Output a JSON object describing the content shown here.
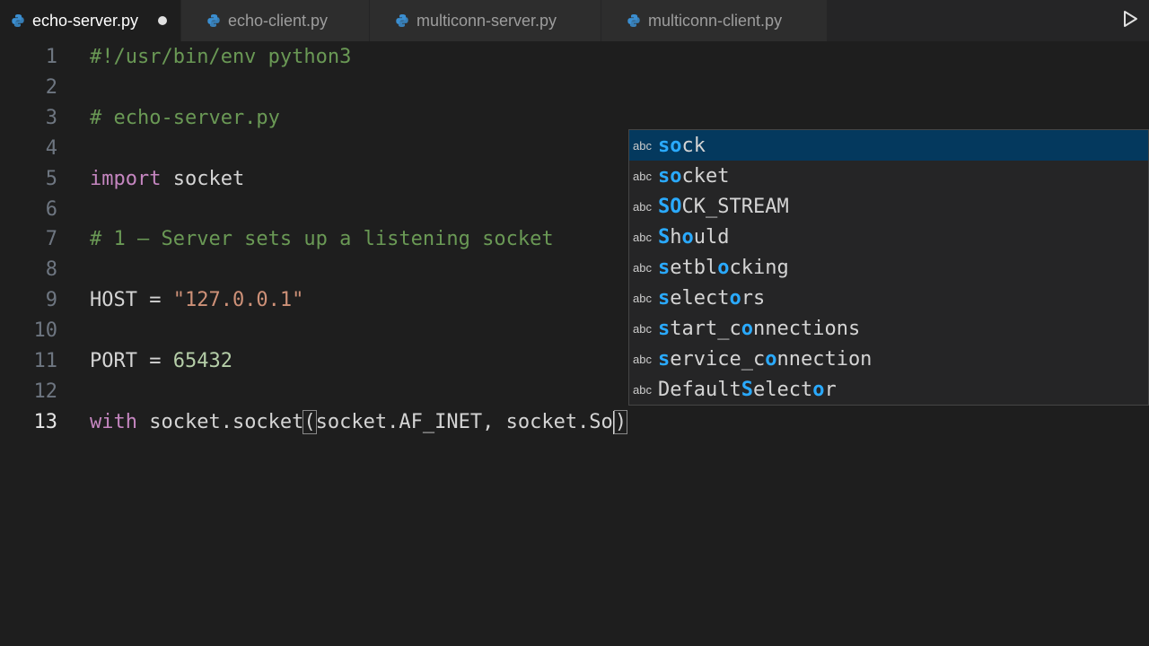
{
  "tabs": [
    {
      "label": "echo-server.py",
      "active": true,
      "modified": true
    },
    {
      "label": "echo-client.py",
      "active": false
    },
    {
      "label": "multiconn-server.py",
      "active": false
    },
    {
      "label": "multiconn-client.py",
      "active": false
    }
  ],
  "run_icon": "play-icon",
  "file_icon": "python-file-icon",
  "editor": {
    "current_line": 13,
    "lines": [
      {
        "n": "1",
        "segments": [
          {
            "t": "#!/usr/bin/env python3",
            "k": "comment"
          }
        ]
      },
      {
        "n": "2",
        "segments": []
      },
      {
        "n": "3",
        "segments": [
          {
            "t": "# echo-server.py",
            "k": "comment"
          }
        ]
      },
      {
        "n": "4",
        "segments": []
      },
      {
        "n": "5",
        "segments": [
          {
            "t": "import",
            "k": "kw"
          },
          {
            "t": " socket",
            "k": "plain"
          }
        ]
      },
      {
        "n": "6",
        "segments": []
      },
      {
        "n": "7",
        "segments": [
          {
            "t": "# 1 – Server sets up a listening socket",
            "k": "comment"
          }
        ]
      },
      {
        "n": "8",
        "segments": []
      },
      {
        "n": "9",
        "segments": [
          {
            "t": "HOST = ",
            "k": "plain"
          },
          {
            "t": "\"127.0.0.1\"",
            "k": "str"
          }
        ]
      },
      {
        "n": "10",
        "segments": []
      },
      {
        "n": "11",
        "segments": [
          {
            "t": "PORT = ",
            "k": "plain"
          },
          {
            "t": "65432",
            "k": "num"
          }
        ]
      },
      {
        "n": "12",
        "segments": []
      },
      {
        "n": "13",
        "segments": [
          {
            "t": "with",
            "k": "kw"
          },
          {
            "t": " socket.socket",
            "k": "plain"
          },
          {
            "t": "(",
            "k": "bracket"
          },
          {
            "t": "socket.AF_INET, socket.So",
            "k": "plain"
          },
          {
            "t": "",
            "k": "cursor"
          },
          {
            "t": ")",
            "k": "bracket"
          }
        ]
      }
    ]
  },
  "suggestions": {
    "kind_label": "abc",
    "items": [
      {
        "parts": [
          {
            "t": "so",
            "h": true
          },
          {
            "t": "ck",
            "h": false
          }
        ],
        "selected": true
      },
      {
        "parts": [
          {
            "t": "so",
            "h": true
          },
          {
            "t": "cket",
            "h": false
          }
        ]
      },
      {
        "parts": [
          {
            "t": "SO",
            "h": true
          },
          {
            "t": "CK_STREAM",
            "h": false
          }
        ]
      },
      {
        "parts": [
          {
            "t": "S",
            "h": true
          },
          {
            "t": "h",
            "h": false
          },
          {
            "t": "o",
            "h": true
          },
          {
            "t": "uld",
            "h": false
          }
        ]
      },
      {
        "parts": [
          {
            "t": "s",
            "h": true
          },
          {
            "t": "etbl",
            "h": false
          },
          {
            "t": "o",
            "h": true
          },
          {
            "t": "cking",
            "h": false
          }
        ]
      },
      {
        "parts": [
          {
            "t": "s",
            "h": true
          },
          {
            "t": "elect",
            "h": false
          },
          {
            "t": "o",
            "h": true
          },
          {
            "t": "rs",
            "h": false
          }
        ]
      },
      {
        "parts": [
          {
            "t": "s",
            "h": true
          },
          {
            "t": "tart_c",
            "h": false
          },
          {
            "t": "o",
            "h": true
          },
          {
            "t": "nnections",
            "h": false
          }
        ]
      },
      {
        "parts": [
          {
            "t": "s",
            "h": true
          },
          {
            "t": "ervice_c",
            "h": false
          },
          {
            "t": "o",
            "h": true
          },
          {
            "t": "nnection",
            "h": false
          }
        ]
      },
      {
        "parts": [
          {
            "t": "Default",
            "h": false
          },
          {
            "t": "S",
            "h": true
          },
          {
            "t": "elect",
            "h": false
          },
          {
            "t": "o",
            "h": true
          },
          {
            "t": "r",
            "h": false
          }
        ]
      }
    ]
  },
  "colors": {
    "editor_bg": "#1e1e1e",
    "comment": "#6a9955",
    "keyword": "#c586c0",
    "string": "#ce9178",
    "number": "#b5cea8",
    "match_highlight": "#2aaaff",
    "selected_suggestion_bg": "#04395e"
  }
}
